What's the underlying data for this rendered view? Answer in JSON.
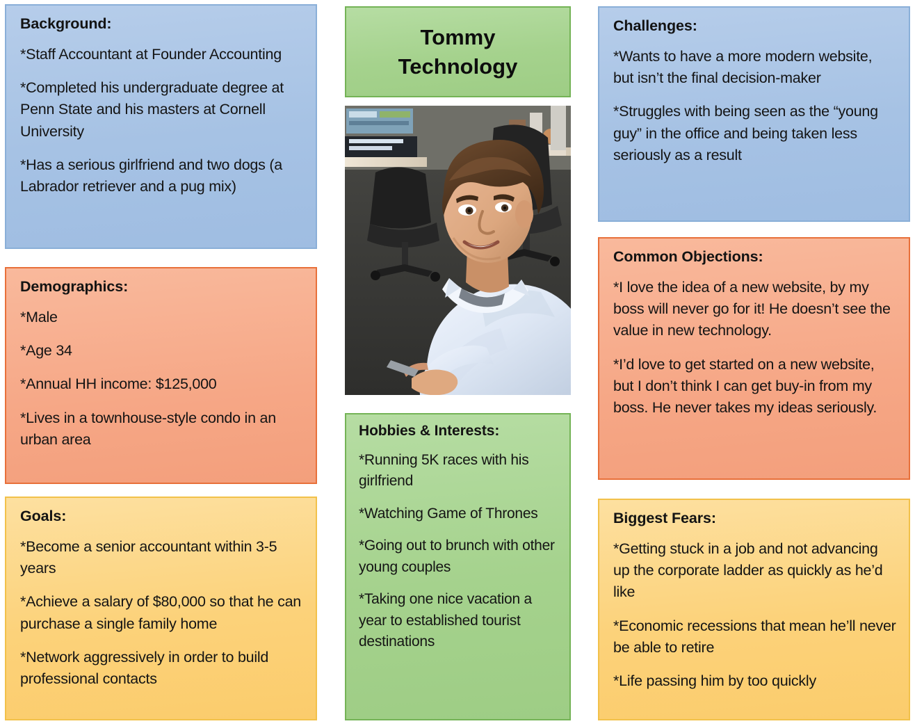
{
  "persona": {
    "name_line1": "Tommy",
    "name_line2": "Technology",
    "photo_alt": "persona-photo-man-in-office"
  },
  "colors": {
    "blue": "#a6c2e4",
    "blue_border": "#8aafd8",
    "orange": "#f6a786",
    "orange_border": "#e8703a",
    "yellow": "#fcd27a",
    "yellow_border": "#f2c14a",
    "green": "#a5d28d",
    "green_border": "#74b356",
    "text": "#141414"
  },
  "background": {
    "title": "Background:",
    "bullets": [
      "*Staff Accountant at Founder Accounting",
      "*Completed his undergraduate degree at Penn State and his masters at Cornell University",
      "*Has a serious girlfriend and two dogs (a Labrador retriever and a pug mix)"
    ]
  },
  "demographics": {
    "title": "Demographics:",
    "bullets": [
      "*Male",
      "*Age 34",
      "*Annual HH income: $125,000",
      "*Lives in a townhouse-style condo in an urban area"
    ]
  },
  "goals": {
    "title": "Goals:",
    "bullets": [
      "*Become a senior accountant within 3-5 years",
      "*Achieve a salary of $80,000 so that he can purchase a single family home",
      "*Network aggressively in order to build professional contacts"
    ]
  },
  "hobbies": {
    "title": "Hobbies & Interests:",
    "bullets": [
      "*Running 5K races with his girlfriend",
      "*Watching Game of Thrones",
      "*Going out to brunch with other young couples",
      "*Taking one nice vacation a year to established tourist destinations"
    ]
  },
  "challenges": {
    "title": "Challenges:",
    "bullets": [
      "*Wants to have a more modern website, but isn’t the final decision-maker",
      "*Struggles with being seen as the “young guy” in the office and being taken less seriously as a result"
    ]
  },
  "objections": {
    "title": "Common Objections:",
    "bullets": [
      "*I love the idea of a new website, by my boss will never go for it!  He doesn’t see the value in new technology.",
      "*I’d love to get started on a new website, but I don’t think I can get buy-in from my boss.  He never takes my ideas seriously."
    ]
  },
  "fears": {
    "title": "Biggest Fears:",
    "bullets": [
      "*Getting stuck in a job and not advancing up the corporate ladder as quickly as he’d like",
      "*Economic recessions that mean he’ll never be able to retire",
      "*Life passing him by too quickly"
    ]
  }
}
